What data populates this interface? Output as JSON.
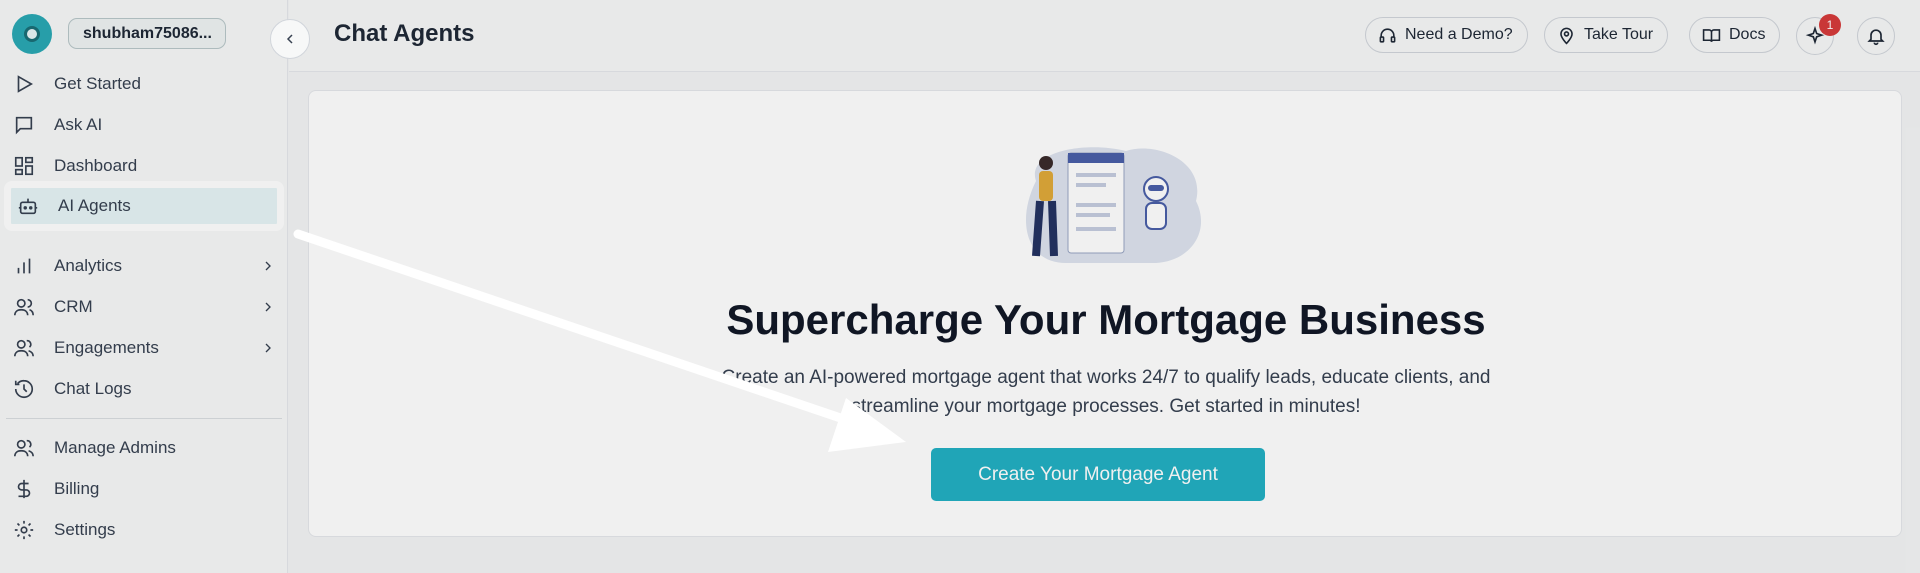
{
  "user": {
    "name": "shubham75086..."
  },
  "sidebar": {
    "items": [
      {
        "label": "Get Started",
        "icon": "play-icon"
      },
      {
        "label": "Ask AI",
        "icon": "message-icon"
      },
      {
        "label": "Dashboard",
        "icon": "dashboard-icon"
      },
      {
        "label": "AI Agents",
        "icon": "bot-icon",
        "active": true
      },
      {
        "label": "Analytics",
        "icon": "bar-chart-icon",
        "expandable": true
      },
      {
        "label": "CRM",
        "icon": "users-icon",
        "expandable": true
      },
      {
        "label": "Engagements",
        "icon": "user-group-icon",
        "expandable": true
      },
      {
        "label": "Chat Logs",
        "icon": "history-icon"
      },
      {
        "label": "Manage Admins",
        "icon": "admin-users-icon"
      },
      {
        "label": "Billing",
        "icon": "dollar-icon"
      },
      {
        "label": "Settings",
        "icon": "gear-icon"
      }
    ]
  },
  "header": {
    "title": "Chat Agents",
    "demo_label": "Need a Demo?",
    "tour_label": "Take Tour",
    "docs_label": "Docs",
    "notification_count": "1"
  },
  "main": {
    "headline": "Supercharge Your Mortgage Business",
    "description": "Create an AI-powered mortgage agent that works 24/7 to qualify leads, educate clients, and streamline your mortgage processes. Get started in minutes!",
    "cta_label": "Create Your Mortgage Agent"
  },
  "colors": {
    "accent": "#23b0c3",
    "active_bg": "#e6f4f6",
    "badge": "#d63b3b"
  }
}
